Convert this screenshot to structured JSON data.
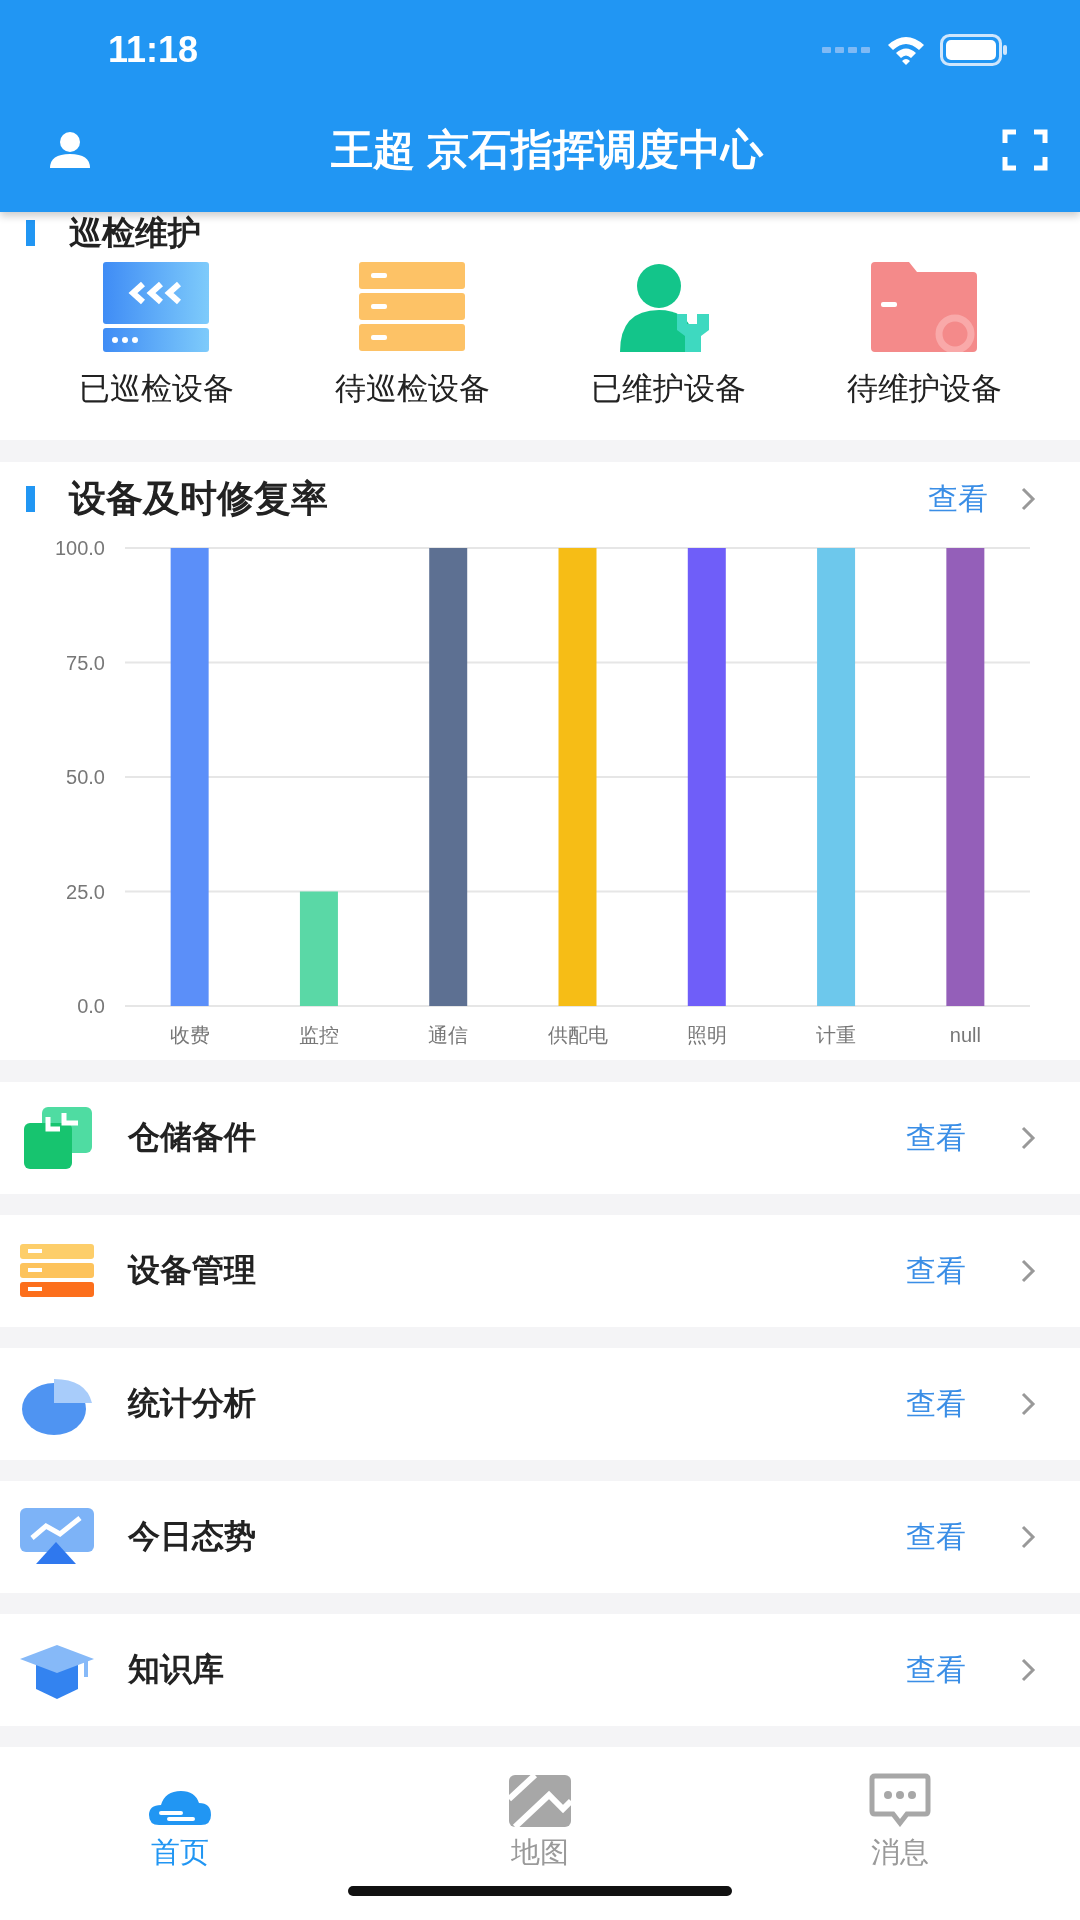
{
  "status_bar": {
    "time": "11:18"
  },
  "header": {
    "title": "王超 京石指挥调度中心"
  },
  "inspection": {
    "title": "巡检维护",
    "items": [
      {
        "kind": "inspected",
        "label": "已巡检设备"
      },
      {
        "kind": "pending_inspection",
        "label": "待巡检设备"
      },
      {
        "kind": "maintained",
        "label": "已维护设备"
      },
      {
        "kind": "pending_maintenance",
        "label": "待维护设备"
      }
    ]
  },
  "repair_rate": {
    "title": "设备及时修复率",
    "link": "查看",
    "chart_data": {
      "type": "bar",
      "categories": [
        "收费",
        "监控",
        "通信",
        "供配电",
        "照明",
        "计重",
        "null"
      ],
      "values": [
        100,
        25,
        100,
        100,
        100,
        100,
        100
      ],
      "colors": [
        "#5b8ff9",
        "#5ad8a6",
        "#5d7092",
        "#f6bd16",
        "#6f5ef9",
        "#6dc8ec",
        "#945fb9"
      ],
      "ylim": [
        0,
        100
      ],
      "grid": true,
      "yticks": [
        {
          "value": 0,
          "label": "0.0"
        },
        {
          "value": 25,
          "label": "25.0"
        },
        {
          "value": 50,
          "label": "50.0"
        },
        {
          "value": 75,
          "label": "75.0"
        },
        {
          "value": 100,
          "label": "100.0"
        }
      ]
    }
  },
  "menu": [
    {
      "kind": "storage",
      "label": "仓储备件",
      "link": "查看"
    },
    {
      "kind": "devices",
      "label": "设备管理",
      "link": "查看"
    },
    {
      "kind": "statistics",
      "label": "统计分析",
      "link": "查看"
    },
    {
      "kind": "trend",
      "label": "今日态势",
      "link": "查看"
    },
    {
      "kind": "knowledge",
      "label": "知识库",
      "link": "查看"
    }
  ],
  "tabs": [
    {
      "kind": "home",
      "label": "首页",
      "selected": true
    },
    {
      "kind": "map",
      "label": "地图",
      "selected": false
    },
    {
      "kind": "messages",
      "label": "消息",
      "selected": false
    }
  ]
}
